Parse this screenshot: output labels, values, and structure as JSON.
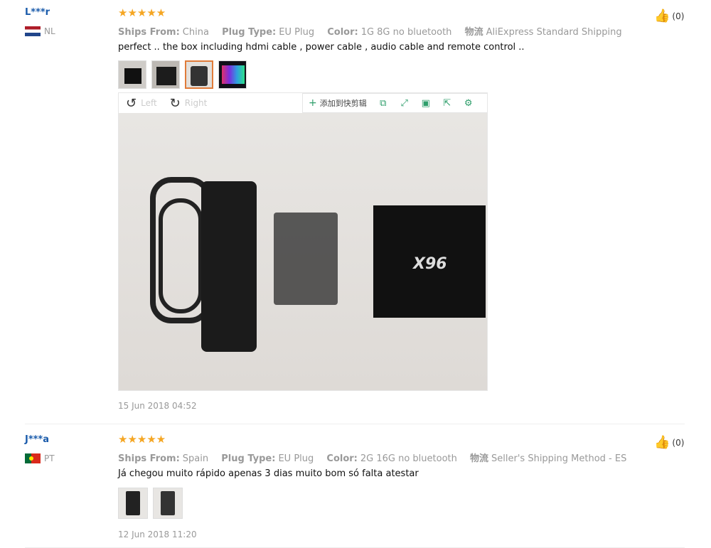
{
  "reviews": [
    {
      "user": "L***r",
      "country": "NL",
      "stars": "★★★★★",
      "ships_from_label": "Ships From:",
      "ships_from": "China",
      "plug_label": "Plug Type:",
      "plug": "EU Plug",
      "color_label": "Color:",
      "color": "1G 8G no bluetooth",
      "logistics_label": "物流",
      "logistics": "AliExpress Standard Shipping",
      "text": "perfect .. the box including hdmi cable , power cable , audio cable and remote control ..",
      "date": "15 Jun 2018 04:52",
      "likes": "(0)"
    },
    {
      "user": "J***a",
      "country": "PT",
      "stars": "★★★★★",
      "ships_from_label": "Ships From:",
      "ships_from": "Spain",
      "plug_label": "Plug Type:",
      "plug": "EU Plug",
      "color_label": "Color:",
      "color": "2G 16G no bluetooth",
      "logistics_label": "物流",
      "logistics": "Seller's Shipping Method - ES",
      "text": "Já chegou muito rápido apenas 3 dias muito bom só falta atestar",
      "date": "12 Jun 2018 11:20",
      "likes": "(0)"
    }
  ],
  "viewer": {
    "rotate_left": "Left",
    "rotate_right": "Right",
    "add_clip": "添加到快剪辑",
    "box_brand": "X96"
  },
  "colors": {
    "accent": "#1a5bab",
    "star": "#f5a623",
    "selected_border": "#e07b39",
    "toolbar_icon": "#2e9e6b"
  }
}
